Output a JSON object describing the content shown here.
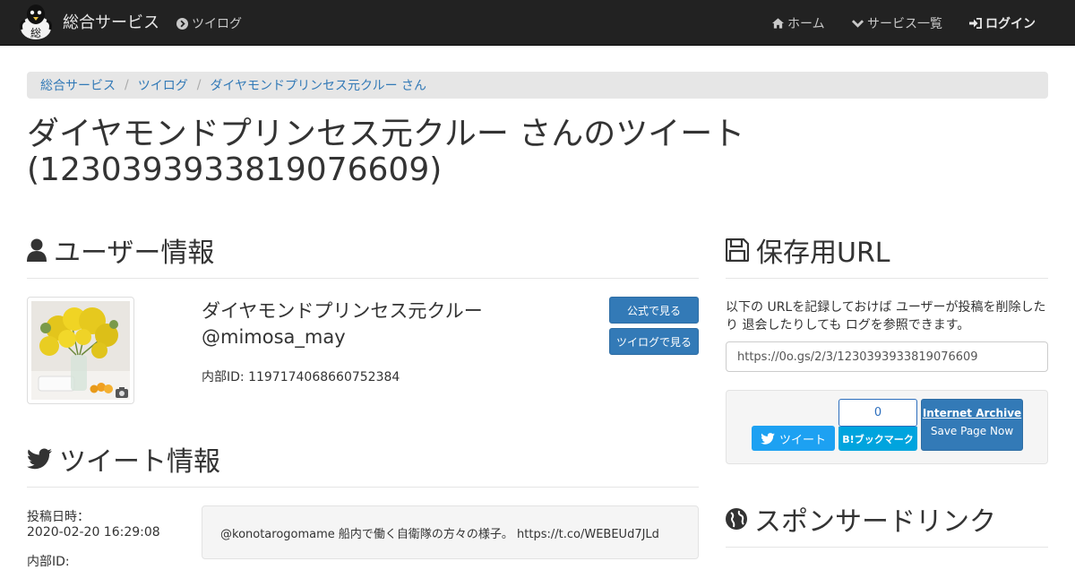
{
  "navbar": {
    "brand": "総合サービス",
    "app_link": "ツイログ",
    "home": "ホーム",
    "services": "サービス一覧",
    "login": "ログイン"
  },
  "breadcrumb": [
    "総合サービス",
    "ツイログ",
    "ダイヤモンドプリンセス元クルー さん"
  ],
  "page_title": "ダイヤモンドプリンセス元クルー さんのツイート(1230393933819076609)",
  "user_section": {
    "heading": "ユーザー情報",
    "display_name": "ダイヤモンドプリンセス元クルー",
    "screen_name": "@mimosa_may",
    "internal_id": "内部ID: 1197174068660752384",
    "btn_official": "公式で見る",
    "btn_twilog": "ツイログで見る"
  },
  "tweet_section": {
    "heading": "ツイート情報",
    "posted_label": "投稿日時：",
    "posted_value": "2020-02-20 16:29:08",
    "internal_label": "内部ID:",
    "text": "@konotarogomame 船内で働く自衛隊の方々の様子。 https://t.co/WEBEUd7JLd"
  },
  "save_section": {
    "heading": "保存用URL",
    "description": "以下の URLを記録しておけば ユーザーが投稿を削除したり 退会したりしても ログを参照できます。",
    "url": "https://0o.gs/2/3/1230393933819076609"
  },
  "share": {
    "tweet": "ツイート",
    "hatena_count": "0",
    "hatena": "B!ブックマーク",
    "ia_title": "Internet Archive",
    "ia_sub": "Save Page Now"
  },
  "sponsor": {
    "heading": "スポンサードリンク"
  },
  "colors": {
    "navbar_bg": "#222222",
    "link": "#337ab7",
    "primary": "#337ab7",
    "twitter": "#1da1f2",
    "hatena": "#00a4de"
  }
}
